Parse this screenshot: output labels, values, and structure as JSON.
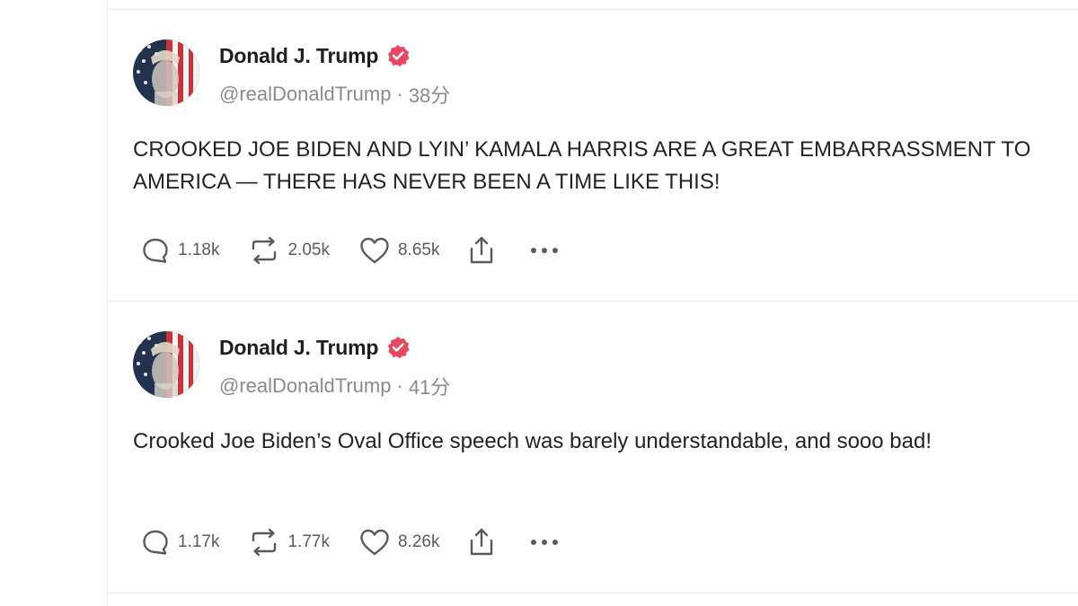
{
  "posts": [
    {
      "author": {
        "display_name": "Donald J. Trump",
        "handle": "@realDonaldTrump",
        "verified_icon": "verified-badge-icon",
        "avatar_icon": "avatar-flag-portrait"
      },
      "time_sep": "·",
      "time": "38分",
      "text": "CROOKED JOE BIDEN AND LYIN’ KAMALA HARRIS ARE A GREAT EMBARRASSMENT TO AMERICA — THERE HAS NEVER BEEN A TIME LIKE THIS!",
      "stats": {
        "replies": "1.18k",
        "retruths": "2.05k",
        "likes": "8.65k"
      }
    },
    {
      "author": {
        "display_name": "Donald J. Trump",
        "handle": "@realDonaldTrump",
        "verified_icon": "verified-badge-icon",
        "avatar_icon": "avatar-flag-portrait"
      },
      "time_sep": "·",
      "time": "41分",
      "text": "Crooked Joe Biden’s Oval Office speech was barely understandable, and sooo bad!",
      "stats": {
        "replies": "1.17k",
        "retruths": "1.77k",
        "likes": "8.26k"
      }
    }
  ],
  "icons": {
    "reply": "reply-bubble-icon",
    "retruth": "retruth-arrows-icon",
    "like": "heart-icon",
    "share": "share-icon",
    "more": "more-dots-icon"
  },
  "colors": {
    "verified": "#e8475f",
    "text": "#232323",
    "muted": "#8a8a8a",
    "icon": "#5a5a5a",
    "divider": "#ececec"
  }
}
